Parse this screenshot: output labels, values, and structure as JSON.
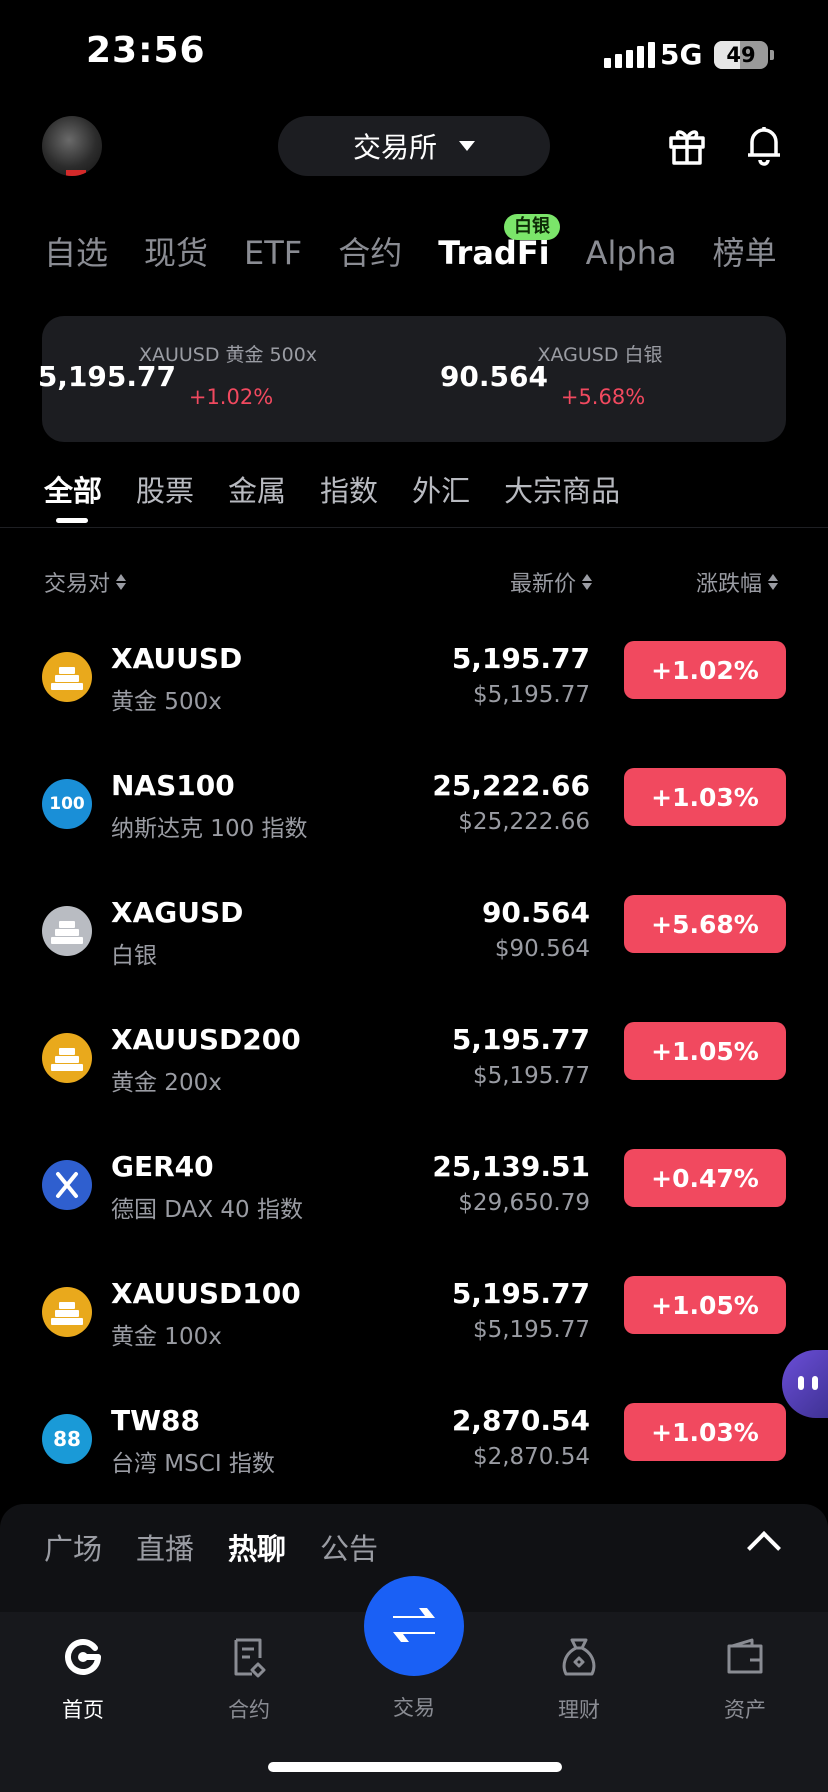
{
  "status_bar": {
    "time": "23:56",
    "network": "5G",
    "battery": "49",
    "battery_level": 0.49
  },
  "header": {
    "exchange_label": "交易所"
  },
  "main_tabs": [
    {
      "label": "自选"
    },
    {
      "label": "现货"
    },
    {
      "label": "ETF"
    },
    {
      "label": "合约"
    },
    {
      "label": "TradFi"
    },
    {
      "label": "Alpha"
    },
    {
      "label": "榜单"
    }
  ],
  "tradfi_badge": "白银",
  "highlights": [
    {
      "name": "XAUUSD 黄金 500x",
      "price": "5,195.77",
      "change": "+1.02%"
    },
    {
      "name": "XAGUSD 白银",
      "price": "90.564",
      "change": "+5.68%"
    }
  ],
  "sub_tabs": [
    {
      "label": "全部"
    },
    {
      "label": "股票"
    },
    {
      "label": "金属"
    },
    {
      "label": "指数"
    },
    {
      "label": "外汇"
    },
    {
      "label": "大宗商品"
    }
  ],
  "columns": {
    "pair": "交易对",
    "price": "最新价",
    "change": "涨跌幅"
  },
  "rows": [
    {
      "symbol": "XAUUSD",
      "name": "黄金 500x",
      "price": "5,195.77",
      "usd": "$5,195.77",
      "change": "+1.02%",
      "icon": "gold-bars-icon"
    },
    {
      "symbol": "NAS100",
      "name": "纳斯达克 100 指数",
      "price": "25,222.66",
      "usd": "$25,222.66",
      "change": "+1.03%",
      "icon": "nas100-icon",
      "icon_text": "100"
    },
    {
      "symbol": "XAGUSD",
      "name": "白银",
      "price": "90.564",
      "usd": "$90.564",
      "change": "+5.68%",
      "icon": "silver-bars-icon"
    },
    {
      "symbol": "XAUUSD200",
      "name": "黄金 200x",
      "price": "5,195.77",
      "usd": "$5,195.77",
      "change": "+1.05%",
      "icon": "gold-bars-icon"
    },
    {
      "symbol": "GER40",
      "name": "德国 DAX 40 指数",
      "price": "25,139.51",
      "usd": "$29,650.79",
      "change": "+0.47%",
      "icon": "ger40-icon"
    },
    {
      "symbol": "XAUUSD100",
      "name": "黄金 100x",
      "price": "5,195.77",
      "usd": "$5,195.77",
      "change": "+1.05%",
      "icon": "gold-bars-icon"
    },
    {
      "symbol": "TW88",
      "name": "台湾 MSCI 指数",
      "price": "2,870.54",
      "usd": "$2,870.54",
      "change": "+1.03%",
      "icon": "tw88-icon",
      "icon_text": "88"
    }
  ],
  "sheet_tabs": [
    {
      "label": "广场"
    },
    {
      "label": "直播"
    },
    {
      "label": "热聊"
    },
    {
      "label": "公告"
    }
  ],
  "nav": {
    "home": "首页",
    "futures": "合约",
    "trade": "交易",
    "earn": "理财",
    "assets": "资产"
  },
  "colors": {
    "up": "#f1495f",
    "accent": "#1a60f5",
    "badge": "#7be56a",
    "background": "#000000"
  }
}
